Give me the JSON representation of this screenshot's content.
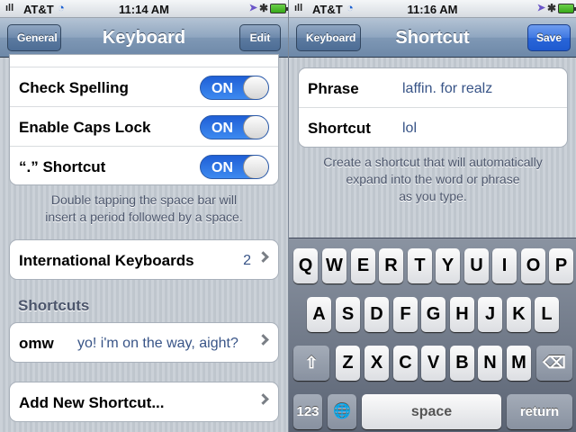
{
  "left": {
    "status": {
      "signal": "ıll",
      "carrier": "AT&T",
      "wifi_icon": "◔",
      "time": "11:14 AM",
      "location_icon": "➤",
      "bluetooth_icon": "✱"
    },
    "nav": {
      "back_label": "General",
      "title": "Keyboard",
      "edit_label": "Edit"
    },
    "toggles": [
      {
        "label": "Check Spelling",
        "state": "ON"
      },
      {
        "label": "Enable Caps Lock",
        "state": "ON"
      },
      {
        "label": "“.” Shortcut",
        "state": "ON"
      }
    ],
    "note_line1": "Double tapping the space bar will",
    "note_line2": "insert a period followed by a space.",
    "intl": {
      "label": "International Keyboards",
      "count": "2"
    },
    "shortcuts_header": "Shortcuts",
    "shortcut_item": {
      "shortcut": "omw",
      "phrase": "yo! i'm on the way, aight?"
    },
    "add_new": "Add New Shortcut..."
  },
  "right": {
    "status": {
      "signal": "ıll",
      "carrier": "AT&T",
      "wifi_icon": "◔",
      "time": "11:16 AM",
      "location_icon": "➤",
      "bluetooth_icon": "✱"
    },
    "nav": {
      "back_label": "Keyboard",
      "title": "Shortcut",
      "save_label": "Save"
    },
    "form": {
      "phrase_label": "Phrase",
      "phrase_value": "laffin. for realz",
      "shortcut_label": "Shortcut",
      "shortcut_value": "lol"
    },
    "note_line1": "Create a shortcut that will automatically",
    "note_line2": "expand into the word or phrase",
    "note_line3": "as you type.",
    "keyboard": {
      "row1": [
        "Q",
        "W",
        "E",
        "R",
        "T",
        "Y",
        "U",
        "I",
        "O",
        "P"
      ],
      "row2": [
        "A",
        "S",
        "D",
        "F",
        "G",
        "H",
        "J",
        "K",
        "L"
      ],
      "row3": [
        "Z",
        "X",
        "C",
        "V",
        "B",
        "N",
        "M"
      ],
      "shift_icon": "⇧",
      "delete_icon": "⌫",
      "numbers_label": "123",
      "globe_icon": "🌐",
      "space_label": "space",
      "return_label": "return"
    }
  }
}
